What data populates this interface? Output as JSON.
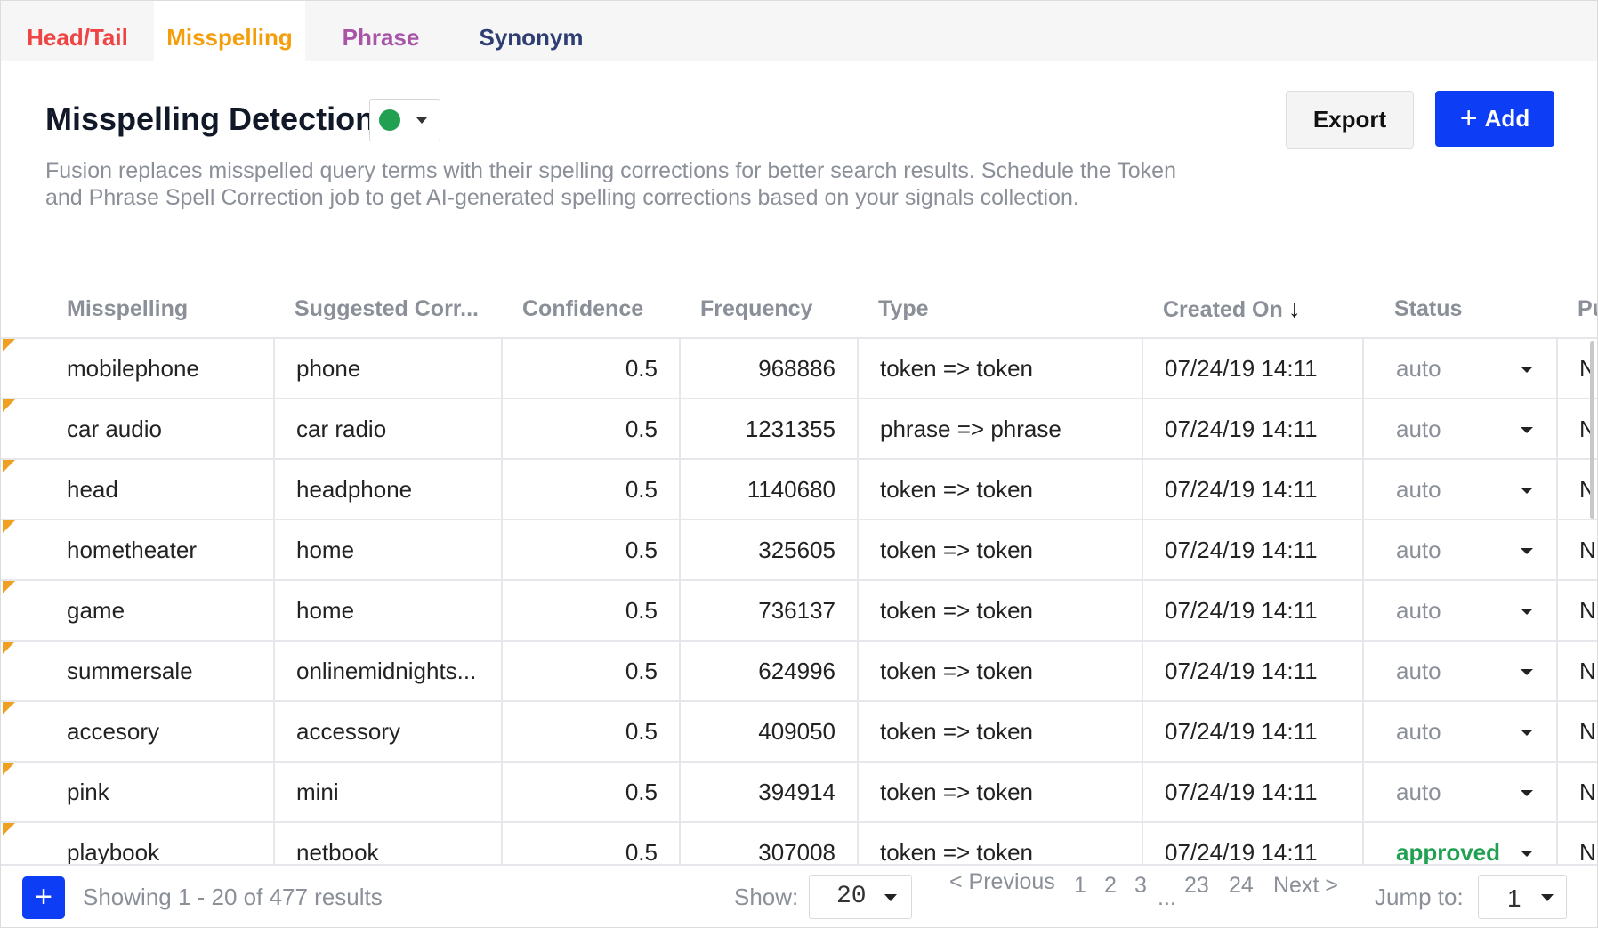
{
  "tabs": [
    {
      "label": "Head/Tail",
      "color": "#ef4444"
    },
    {
      "label": "Misspelling",
      "color": "#f59e0b"
    },
    {
      "label": "Phrase",
      "color": "#a855a8"
    },
    {
      "label": "Synonym",
      "color": "#2f3f73"
    }
  ],
  "header": {
    "title": "Misspelling Detection",
    "status_color": "#22a052",
    "description": "Fusion replaces misspelled query terms with their spelling corrections for better search results. Schedule the Token and Phrase Spell Correction job to get AI-generated spelling corrections based on your signals collection.",
    "export_label": "Export",
    "add_label": "Add"
  },
  "table": {
    "columns": [
      "Misspelling",
      "Suggested Corr...",
      "Confidence",
      "Frequency",
      "Type",
      "Created On",
      "Status",
      "Pu"
    ],
    "sort_indicator": "↓",
    "rows": [
      {
        "misspelling": "mobilephone",
        "suggested": "phone",
        "confidence": "0.5",
        "frequency": "968886",
        "type": "token => token",
        "created": "07/24/19 14:11",
        "status": "auto",
        "extra": "N"
      },
      {
        "misspelling": "car audio",
        "suggested": "car radio",
        "confidence": "0.5",
        "frequency": "1231355",
        "type": "phrase => phrase",
        "created": "07/24/19 14:11",
        "status": "auto",
        "extra": "N"
      },
      {
        "misspelling": "head",
        "suggested": "headphone",
        "confidence": "0.5",
        "frequency": "1140680",
        "type": "token => token",
        "created": "07/24/19 14:11",
        "status": "auto",
        "extra": "N"
      },
      {
        "misspelling": "hometheater",
        "suggested": "home",
        "confidence": "0.5",
        "frequency": "325605",
        "type": "token => token",
        "created": "07/24/19 14:11",
        "status": "auto",
        "extra": "N"
      },
      {
        "misspelling": "game",
        "suggested": "home",
        "confidence": "0.5",
        "frequency": "736137",
        "type": "token => token",
        "created": "07/24/19 14:11",
        "status": "auto",
        "extra": "N"
      },
      {
        "misspelling": "summersale",
        "suggested": "onlinemidnights...",
        "confidence": "0.5",
        "frequency": "624996",
        "type": "token => token",
        "created": "07/24/19 14:11",
        "status": "auto",
        "extra": "N"
      },
      {
        "misspelling": "accesory",
        "suggested": "accessory",
        "confidence": "0.5",
        "frequency": "409050",
        "type": "token => token",
        "created": "07/24/19 14:11",
        "status": "auto",
        "extra": "N"
      },
      {
        "misspelling": "pink",
        "suggested": "mini",
        "confidence": "0.5",
        "frequency": "394914",
        "type": "token => token",
        "created": "07/24/19 14:11",
        "status": "auto",
        "extra": "N"
      },
      {
        "misspelling": "playbook",
        "suggested": "netbook",
        "confidence": "0.5",
        "frequency": "307008",
        "type": "token => token",
        "created": "07/24/19 14:11",
        "status": "approved",
        "extra": "N"
      }
    ]
  },
  "footer": {
    "showing": "Showing 1 - 20 of 477 results",
    "show_label": "Show:",
    "page_size": "20",
    "prev": "< Previous",
    "pages": [
      "1",
      "2",
      "3",
      "...",
      "23",
      "24"
    ],
    "next": "Next >",
    "jump_label": "Jump to:",
    "jump_value": "1"
  }
}
